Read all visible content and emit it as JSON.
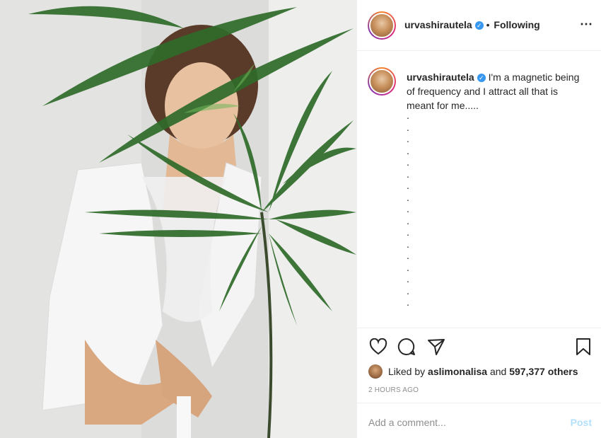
{
  "post": {
    "username": "urvashirautela",
    "follow_status": "Following",
    "separator": "•",
    "more_icon": "⋯",
    "caption_text": "I'm a magnetic being of frequency and I attract all that is meant for me.....",
    "caption_dots": ". . . . . . . . . . . . . . . . ."
  },
  "engagement": {
    "liked_by_prefix": "Liked by",
    "liked_by_user": "aslimonalisa",
    "and_text": "and",
    "likes_count": "597,377 others",
    "timestamp": "2 HOURS AGO"
  },
  "comment": {
    "placeholder": "Add a comment...",
    "post_label": "Post"
  },
  "icons": {
    "like": "heart-icon",
    "comment": "comment-icon",
    "share": "share-icon",
    "save": "bookmark-icon",
    "verified": "verified-badge-icon"
  }
}
